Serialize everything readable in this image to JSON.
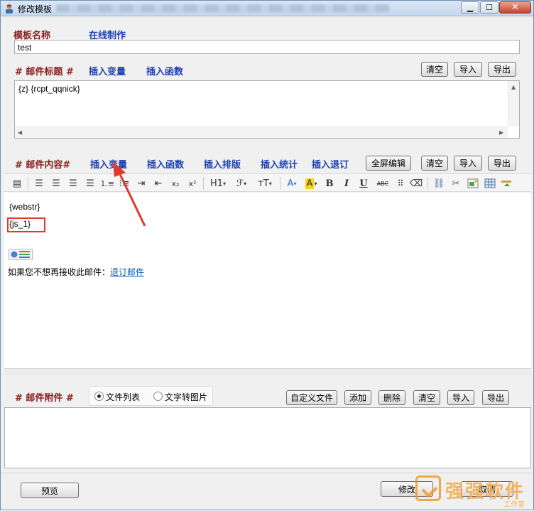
{
  "window": {
    "title": "修改模板",
    "title_extra_blurred": true,
    "buttons": [
      "minimize",
      "maximize",
      "close"
    ]
  },
  "template": {
    "name_label": "模板名称",
    "online_make": "在线制作",
    "name_value": "test"
  },
  "subject": {
    "label": "# 邮件标题 #",
    "insert_var": "插入变量",
    "insert_func": "插入函数",
    "clear": "清空",
    "import": "导入",
    "export": "导出",
    "value": "{z} {rcpt_qqnick}"
  },
  "content": {
    "label": "# 邮件内容#",
    "insert_var": "插入变量",
    "insert_func": "插入函数",
    "insert_layout": "插入排版",
    "insert_stats": "插入统计",
    "insert_unsub": "插入退订",
    "fullscreen": "全屏编辑",
    "clear": "清空",
    "import": "导入",
    "export": "导出",
    "lines": [
      "{webstr}",
      "{js_1}"
    ],
    "unsub_prefix": "如果您不想再接收此邮件：",
    "unsub_link": "退订邮件"
  },
  "toolbar_icons": [
    "source-icon",
    "align-left-icon",
    "align-center-icon",
    "align-right-icon",
    "align-justify-icon",
    "ordered-list-icon",
    "unordered-list-icon",
    "indent-icon",
    "outdent-icon",
    "subscript-icon",
    "superscript-icon",
    "heading-icon",
    "font-family-icon",
    "font-size-icon",
    "font-color-icon",
    "highlight-color-icon",
    "bold-icon",
    "italic-icon",
    "underline-icon",
    "strikethrough-icon",
    "horizontal-rule-icon",
    "eraser-icon",
    "link-icon",
    "unlink-icon",
    "image-icon",
    "table-icon",
    "insert-icon"
  ],
  "toolbar": {
    "h1": "H1",
    "font": "ℱ",
    "size": "тT",
    "color_a": "A",
    "bg_a": "A",
    "bold": "B",
    "italic": "I",
    "underline": "U",
    "strike": "ABC"
  },
  "attachment": {
    "label": "# 邮件附件 #",
    "opt_file_list": "文件列表",
    "opt_text_to_image": "文字转图片",
    "selected": "文件列表",
    "custom_file": "自定义文件",
    "add": "添加",
    "delete": "删除",
    "clear": "清空",
    "import": "导入",
    "export": "导出"
  },
  "footer": {
    "preview": "预览",
    "modify": "修改",
    "cancel": "取消"
  },
  "watermark": {
    "brand": "强强软件",
    "sub": "工作室"
  },
  "colors": {
    "label_red": "#8b1c1c",
    "label_blue": "#1b3fb3",
    "highlight_red": "#e0392b",
    "watermark_orange": "#f29a2e"
  }
}
